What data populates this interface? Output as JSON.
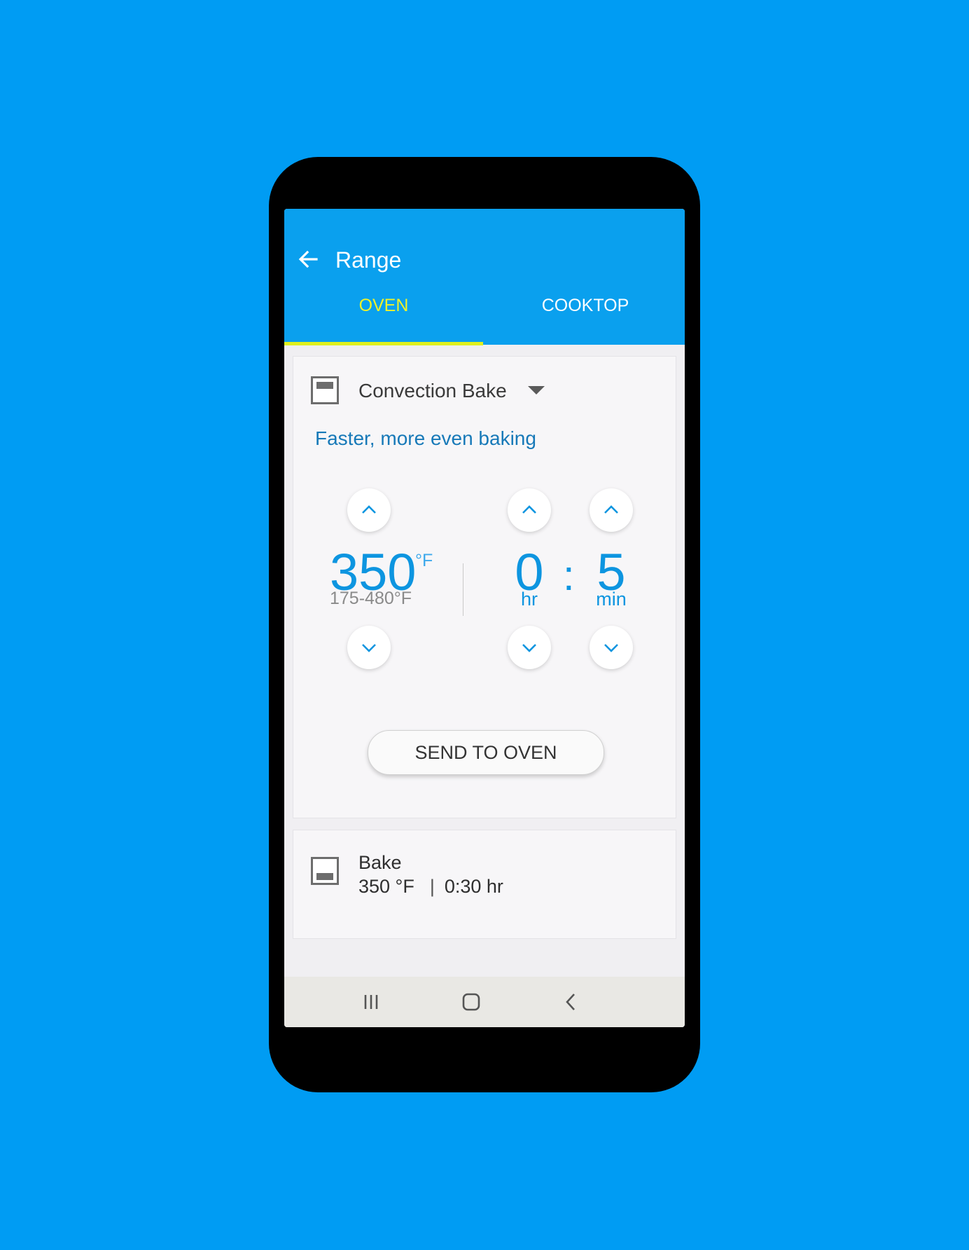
{
  "app": {
    "title": "Range"
  },
  "tabs": [
    {
      "label": "OVEN",
      "active": true
    },
    {
      "label": "COOKTOP",
      "active": false
    }
  ],
  "colors": {
    "background": "#009cf3",
    "appbar": "#0aa0ee",
    "active_tab": "#eef22a",
    "accent_value": "#0d95e0",
    "description": "#1779b8"
  },
  "oven": {
    "mode": "Convection Bake",
    "mode_icon": "oven-top-element-icon",
    "description": "Faster, more even baking",
    "temperature": {
      "value": "350",
      "unit": "°F",
      "range": "175-480°F"
    },
    "timer": {
      "hours": "0",
      "hours_unit": "hr",
      "separator": ":",
      "minutes": "5",
      "minutes_unit": "min"
    },
    "send_label": "SEND TO OVEN"
  },
  "recent": {
    "title": "Bake",
    "temperature": "350 °F",
    "separator": "|",
    "duration": "0:30 hr",
    "icon": "oven-bottom-element-icon"
  },
  "navbar": {
    "recents_icon": "recent-apps-icon",
    "home_icon": "home-icon",
    "back_icon": "back-nav-icon"
  }
}
